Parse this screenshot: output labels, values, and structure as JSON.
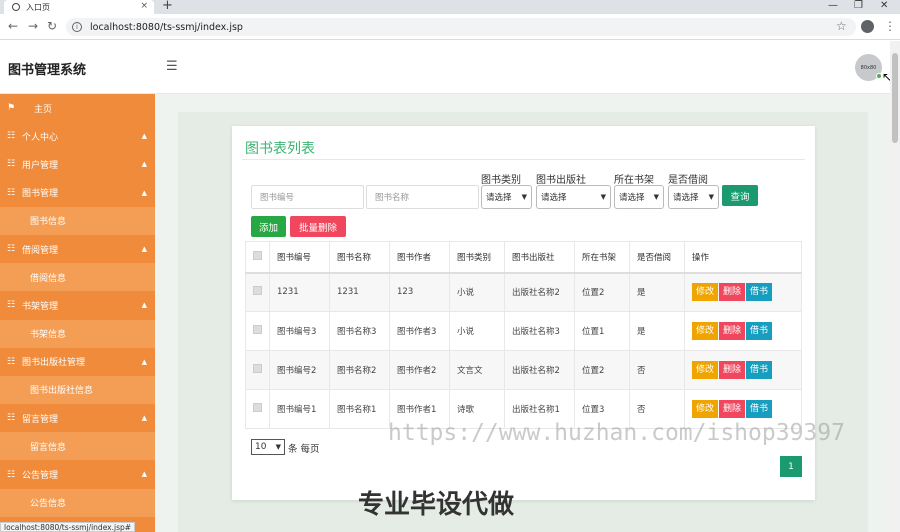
{
  "browser": {
    "tab_title": "入口页",
    "tab_close": "×",
    "new_tab": "+",
    "url": "localhost:8080/ts-ssmj/index.jsp",
    "status_url": "localhost:8080/ts-ssmj/index.jsp#"
  },
  "header": {
    "app_title": "图书管理系统",
    "avatar_text": "80x80"
  },
  "sidebar": {
    "items": [
      {
        "label": "主页",
        "type": "home"
      },
      {
        "label": "个人中心",
        "type": "parent"
      },
      {
        "label": "用户管理",
        "type": "parent"
      },
      {
        "label": "图书管理",
        "type": "parent"
      },
      {
        "label": "图书信息",
        "type": "child"
      },
      {
        "label": "借阅管理",
        "type": "parent"
      },
      {
        "label": "借阅信息",
        "type": "child"
      },
      {
        "label": "书架管理",
        "type": "parent"
      },
      {
        "label": "书架信息",
        "type": "child"
      },
      {
        "label": "图书出版社管理",
        "type": "parent"
      },
      {
        "label": "图书出版社信息",
        "type": "child"
      },
      {
        "label": "留言管理",
        "type": "parent"
      },
      {
        "label": "留言信息",
        "type": "child"
      },
      {
        "label": "公告管理",
        "type": "parent"
      },
      {
        "label": "公告信息",
        "type": "child"
      }
    ]
  },
  "main": {
    "card_title": "图书表列表",
    "filters": {
      "book_no_placeholder": "图书编号",
      "book_name_placeholder": "图书名称",
      "category_label": "图书类别",
      "publisher_label": "图书出版社",
      "shelf_label": "所在书架",
      "borrowed_label": "是否借阅",
      "select_default": "请选择",
      "search_button": "查询"
    },
    "actions": {
      "add": "添加",
      "batch_delete": "批量删除"
    },
    "table": {
      "columns": [
        "图书编号",
        "图书名称",
        "图书作者",
        "图书类别",
        "图书出版社",
        "所在书架",
        "是否借阅",
        "操作"
      ],
      "rows": [
        {
          "no": "1231",
          "name": "1231",
          "author": "123",
          "category": "小说",
          "publisher": "出版社名称2",
          "shelf": "位置2",
          "borrowed": "是"
        },
        {
          "no": "图书编号3",
          "name": "图书名称3",
          "author": "图书作者3",
          "category": "小说",
          "publisher": "出版社名称3",
          "shelf": "位置1",
          "borrowed": "是"
        },
        {
          "no": "图书编号2",
          "name": "图书名称2",
          "author": "图书作者2",
          "category": "文言文",
          "publisher": "出版社名称2",
          "shelf": "位置2",
          "borrowed": "否"
        },
        {
          "no": "图书编号1",
          "name": "图书名称1",
          "author": "图书作者1",
          "category": "诗歌",
          "publisher": "出版社名称1",
          "shelf": "位置3",
          "borrowed": "否"
        }
      ],
      "row_actions": {
        "edit": "修改",
        "delete": "删除",
        "borrow": "借书"
      }
    },
    "pagination": {
      "page_size": "10",
      "page_size_label": "条 每页",
      "current_page": "1"
    }
  },
  "watermarks": {
    "url_text": "https://www.huzhan.com/ishop39397",
    "promo_text": "专业毕设代做"
  },
  "colors": {
    "sidebar_bg": "#ef8b3a",
    "sidebar_child_bg": "#f39d55",
    "title_green": "#3cb371",
    "primary_green": "#1a9a6e",
    "danger_red": "#f0475e",
    "warning_orange": "#f0a400",
    "info_blue": "#179dbd"
  }
}
